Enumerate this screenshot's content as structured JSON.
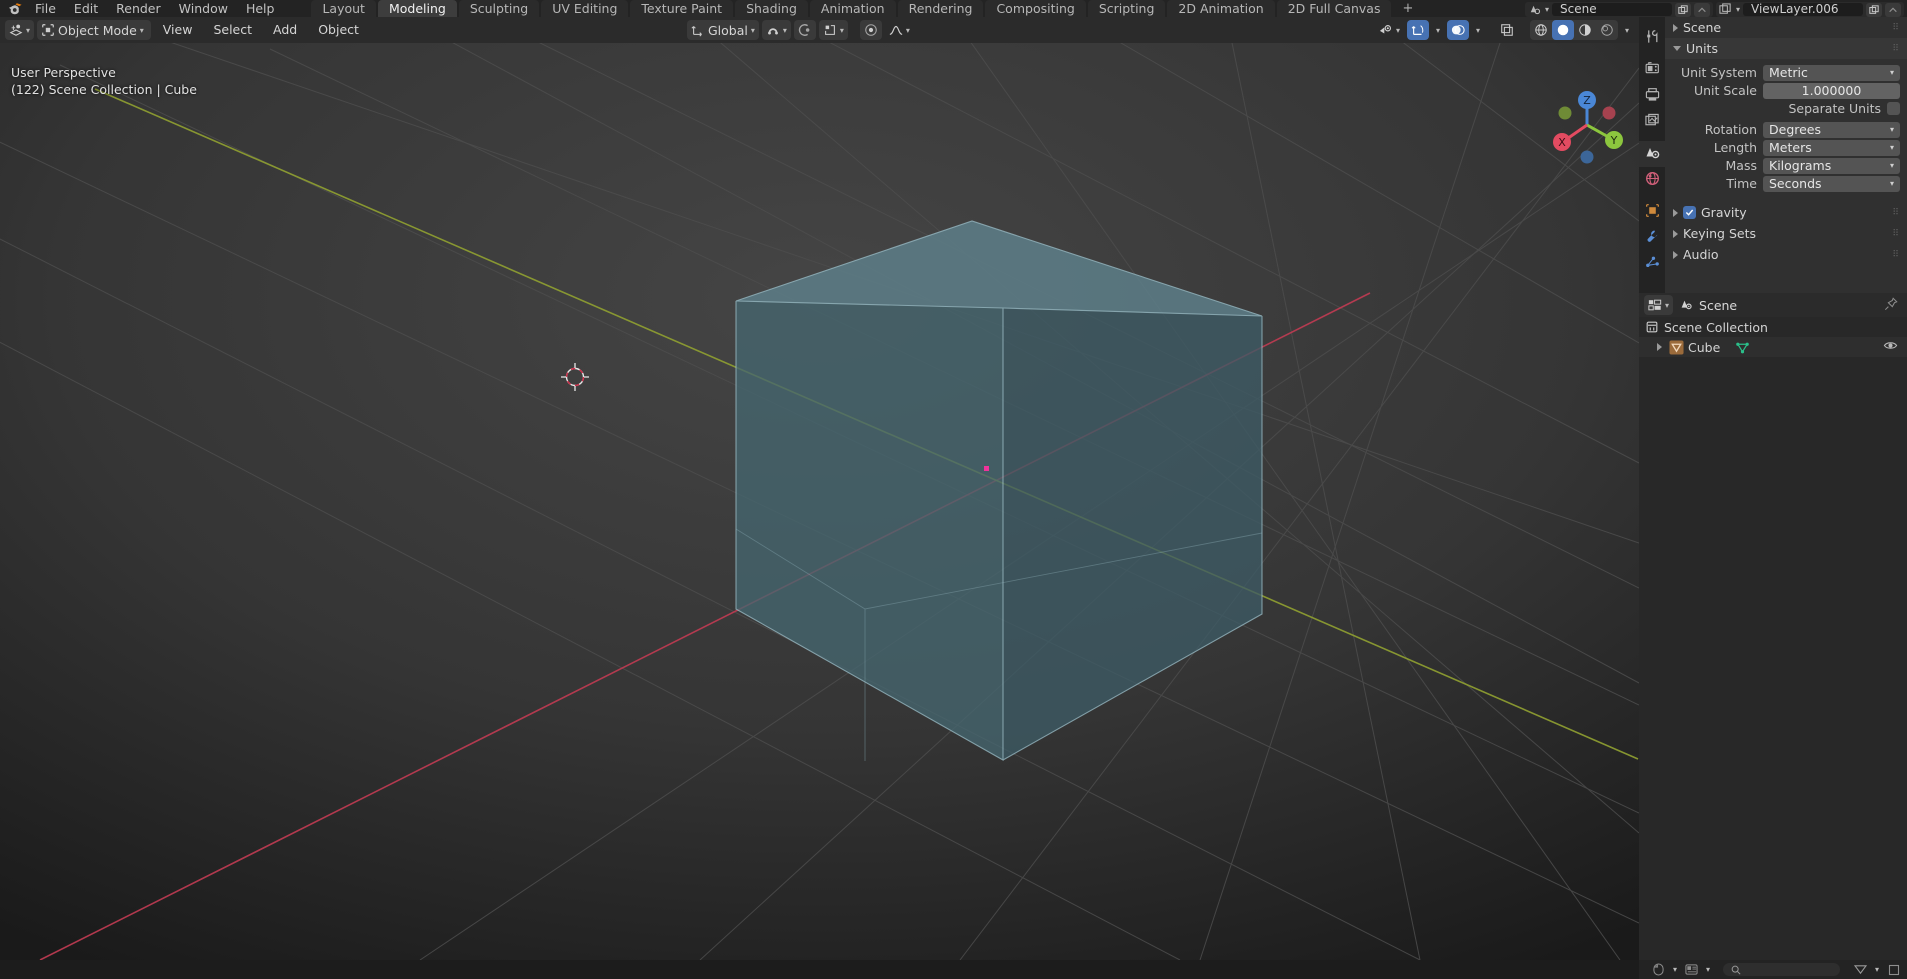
{
  "app": {
    "name": "Blender"
  },
  "topbar": {
    "menus": [
      "File",
      "Edit",
      "Render",
      "Window",
      "Help"
    ],
    "workspaces": [
      {
        "label": "Layout",
        "active": false
      },
      {
        "label": "Modeling",
        "active": true
      },
      {
        "label": "Sculpting",
        "active": false
      },
      {
        "label": "UV Editing",
        "active": false
      },
      {
        "label": "Texture Paint",
        "active": false
      },
      {
        "label": "Shading",
        "active": false
      },
      {
        "label": "Animation",
        "active": false
      },
      {
        "label": "Rendering",
        "active": false
      },
      {
        "label": "Compositing",
        "active": false
      },
      {
        "label": "Scripting",
        "active": false
      },
      {
        "label": "2D Animation",
        "active": false
      },
      {
        "label": "2D Full Canvas",
        "active": false
      }
    ],
    "add_workspace_label": "+",
    "scene_name": "Scene",
    "view_layer_name": "ViewLayer.006"
  },
  "viewport": {
    "header": {
      "editor_type_icon": "editor-type-3d-viewport-icon",
      "mode": "Object Mode",
      "menus": [
        "View",
        "Select",
        "Add",
        "Object"
      ],
      "transform_orientation": "Global",
      "snap_icon": "magnet-icon",
      "snap_target_icon": "snap-target-icon",
      "proportional_icon": "proportional-editing-icon",
      "falloff_icon": "falloff-curve-icon",
      "visibility_icon": "object-types-visibility-icon",
      "gizmo_icon": "gizmo-icon",
      "overlays_icon": "overlays-icon",
      "xray_icon": "toggle-xray-icon",
      "shading_modes": [
        "wireframe",
        "solid",
        "material-preview",
        "rendered"
      ],
      "shading_active": "solid"
    },
    "overlay_text_line1": "User Perspective",
    "overlay_text_line2": "(122) Scene Collection | Cube",
    "gizmo_axes": [
      {
        "label": "Z",
        "color": "#3b7fd4"
      },
      {
        "label": "Y",
        "color": "#7ec31c"
      },
      {
        "label": "X",
        "color": "#e4485b"
      }
    ],
    "object": {
      "name": "Cube",
      "top_face_color": "#5d7d87",
      "left_face_color": "#456670",
      "right_face_color": "#3d5b65",
      "edge_color": "#8fb3bd"
    },
    "cursor_3d_icon": "3d-cursor-icon",
    "origin_dot_color": "#f0339b",
    "axis_x_color": "#c7425a",
    "axis_y_color": "#8c9e2e",
    "grid_color": "#4a4a4a"
  },
  "properties": {
    "tabs": [
      {
        "name": "tool",
        "icon": "tool-icon",
        "active": false
      },
      {
        "name": "render",
        "icon": "render-icon",
        "active": false
      },
      {
        "name": "output",
        "icon": "output-printer-icon",
        "active": false
      },
      {
        "name": "view-layer",
        "icon": "view-layer-images-icon",
        "active": false
      },
      {
        "name": "scene",
        "icon": "scene-icon",
        "active": true
      },
      {
        "name": "world",
        "icon": "world-globe-icon",
        "active": false
      },
      {
        "name": "object",
        "icon": "object-icon",
        "active": false
      },
      {
        "name": "modifiers",
        "icon": "wrench-icon",
        "active": false
      },
      {
        "name": "particles",
        "icon": "particles-icon",
        "active": false
      }
    ],
    "panels": [
      {
        "title": "Scene",
        "expanded": false
      },
      {
        "title": "Units",
        "expanded": true
      },
      {
        "title": "Gravity",
        "expanded": false,
        "checkbox": true
      },
      {
        "title": "Keying Sets",
        "expanded": false
      },
      {
        "title": "Audio",
        "expanded": false
      }
    ],
    "units": {
      "unit_system_label": "Unit System",
      "unit_system_value": "Metric",
      "unit_scale_label": "Unit Scale",
      "unit_scale_value": "1.000000",
      "separate_units_label": "Separate Units",
      "separate_units_checked": false,
      "rotation_label": "Rotation",
      "rotation_value": "Degrees",
      "length_label": "Length",
      "length_value": "Meters",
      "mass_label": "Mass",
      "mass_value": "Kilograms",
      "time_label": "Time",
      "time_value": "Seconds"
    }
  },
  "outliner": {
    "display_mode_icon": "outliner-display-mode-icon",
    "scene_icon": "scene-icon",
    "scene_name": "Scene",
    "pin_icon": "pin-icon",
    "rows": [
      {
        "label": "Scene Collection",
        "icon": "collection-icon",
        "indent": 0,
        "expandable": false,
        "selected": false
      },
      {
        "label": "Cube",
        "icon": "mesh-object-icon",
        "indent": 1,
        "expandable": true,
        "selected": true,
        "data_icon": "mesh-data-icon",
        "visibility_icon": "eye-icon"
      }
    ]
  },
  "statusbar": {
    "icons": [
      "mouse-left-icon",
      "mouse-right-icon",
      "search-icon",
      "blender-version-icon"
    ]
  },
  "colors": {
    "accent_blue": "#4772b3",
    "header_bg": "#2b2b2b",
    "panel_bg": "#303030",
    "outliner_bg": "#282828",
    "topbar_bg": "#232323"
  }
}
